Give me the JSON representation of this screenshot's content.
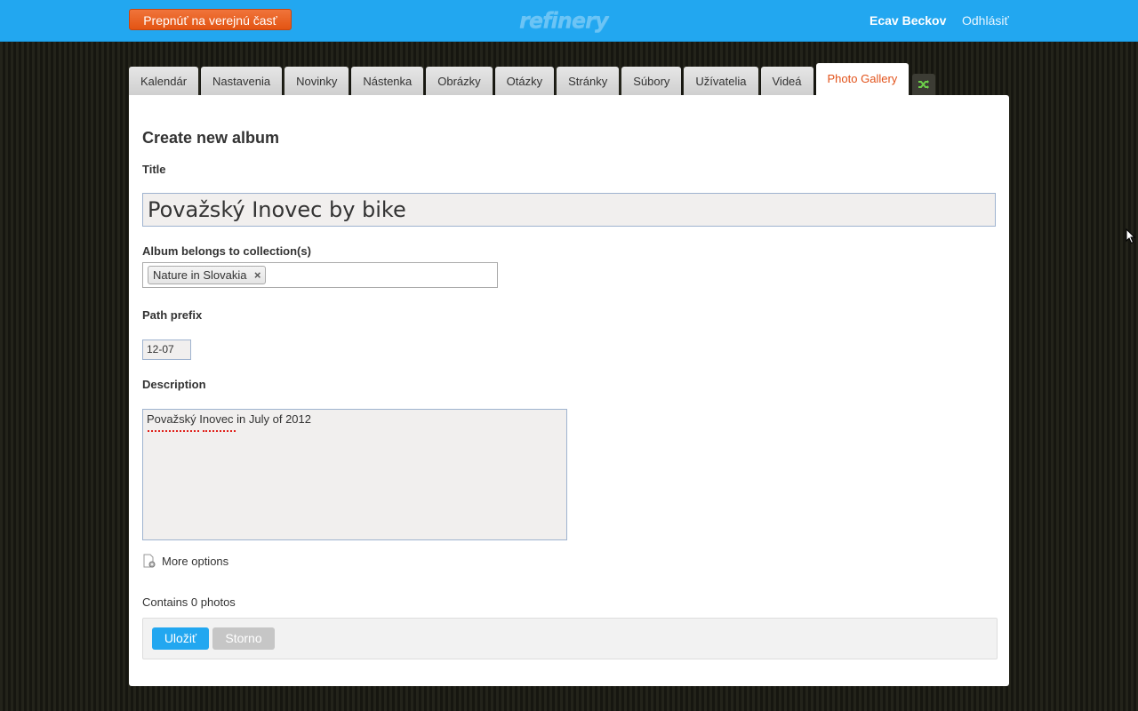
{
  "topbar": {
    "switch_label": "Prepnúť na verejnú časť",
    "logo_text": "refinery",
    "user_name": "Ecav Beckov",
    "logout_label": "Odhlásiť",
    "bg_color": "#22a7f0"
  },
  "tabs": [
    {
      "label": "Kalendár",
      "active": false
    },
    {
      "label": "Nastavenia",
      "active": false
    },
    {
      "label": "Novinky",
      "active": false
    },
    {
      "label": "Nástenka",
      "active": false
    },
    {
      "label": "Obrázky",
      "active": false
    },
    {
      "label": "Otázky",
      "active": false
    },
    {
      "label": "Stránky",
      "active": false
    },
    {
      "label": "Súbory",
      "active": false
    },
    {
      "label": "Užívatelia",
      "active": false
    },
    {
      "label": "Videá",
      "active": false
    },
    {
      "label": "Photo Gallery",
      "active": true
    }
  ],
  "reorder_icon": "shuffle-icon",
  "form": {
    "heading": "Create new album",
    "title_label": "Title",
    "title_value": "Považský Inovec by bike",
    "collections_label": "Album belongs to collection(s)",
    "collections": [
      {
        "label": "Nature in Slovakia"
      }
    ],
    "path_prefix_label": "Path prefix",
    "path_prefix_value": "12-07",
    "description_label": "Description",
    "description_value": "Považský Inovec in July of 2012",
    "more_options_label": "More options",
    "contains_text": "Contains 0 photos",
    "save_label": "Uložiť",
    "cancel_label": "Storno"
  },
  "colors": {
    "accent_orange": "#e2531b",
    "save_blue": "#22a7f0",
    "cancel_gray": "#c6c6c6"
  }
}
